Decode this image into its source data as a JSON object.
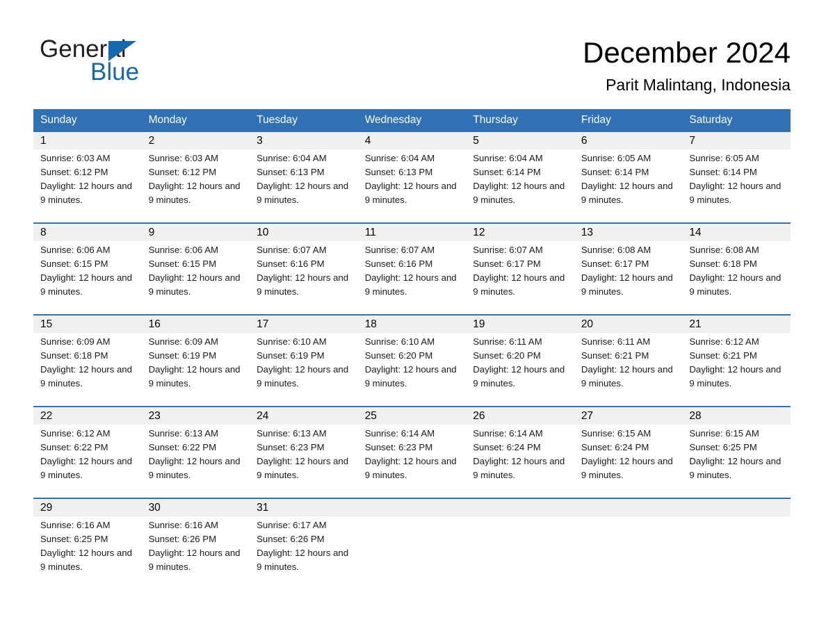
{
  "logo": {
    "word1": "General",
    "word2": "Blue",
    "triangle_color": "#1368b0",
    "text_color": "#231f20"
  },
  "header": {
    "title": "December 2024",
    "subtitle": "Parit Malintang, Indonesia"
  },
  "theme": {
    "header_blue": "#3071b5",
    "daynum_strip": "#f0f0f0",
    "header_text": "#ffffff"
  },
  "calendar": {
    "weekdays": [
      "Sunday",
      "Monday",
      "Tuesday",
      "Wednesday",
      "Thursday",
      "Friday",
      "Saturday"
    ],
    "weeks": [
      [
        {
          "day": "1",
          "sunrise": "Sunrise: 6:03 AM",
          "sunset": "Sunset: 6:12 PM",
          "daylight": "Daylight: 12 hours and 9 minutes."
        },
        {
          "day": "2",
          "sunrise": "Sunrise: 6:03 AM",
          "sunset": "Sunset: 6:12 PM",
          "daylight": "Daylight: 12 hours and 9 minutes."
        },
        {
          "day": "3",
          "sunrise": "Sunrise: 6:04 AM",
          "sunset": "Sunset: 6:13 PM",
          "daylight": "Daylight: 12 hours and 9 minutes."
        },
        {
          "day": "4",
          "sunrise": "Sunrise: 6:04 AM",
          "sunset": "Sunset: 6:13 PM",
          "daylight": "Daylight: 12 hours and 9 minutes."
        },
        {
          "day": "5",
          "sunrise": "Sunrise: 6:04 AM",
          "sunset": "Sunset: 6:14 PM",
          "daylight": "Daylight: 12 hours and 9 minutes."
        },
        {
          "day": "6",
          "sunrise": "Sunrise: 6:05 AM",
          "sunset": "Sunset: 6:14 PM",
          "daylight": "Daylight: 12 hours and 9 minutes."
        },
        {
          "day": "7",
          "sunrise": "Sunrise: 6:05 AM",
          "sunset": "Sunset: 6:14 PM",
          "daylight": "Daylight: 12 hours and 9 minutes."
        }
      ],
      [
        {
          "day": "8",
          "sunrise": "Sunrise: 6:06 AM",
          "sunset": "Sunset: 6:15 PM",
          "daylight": "Daylight: 12 hours and 9 minutes."
        },
        {
          "day": "9",
          "sunrise": "Sunrise: 6:06 AM",
          "sunset": "Sunset: 6:15 PM",
          "daylight": "Daylight: 12 hours and 9 minutes."
        },
        {
          "day": "10",
          "sunrise": "Sunrise: 6:07 AM",
          "sunset": "Sunset: 6:16 PM",
          "daylight": "Daylight: 12 hours and 9 minutes."
        },
        {
          "day": "11",
          "sunrise": "Sunrise: 6:07 AM",
          "sunset": "Sunset: 6:16 PM",
          "daylight": "Daylight: 12 hours and 9 minutes."
        },
        {
          "day": "12",
          "sunrise": "Sunrise: 6:07 AM",
          "sunset": "Sunset: 6:17 PM",
          "daylight": "Daylight: 12 hours and 9 minutes."
        },
        {
          "day": "13",
          "sunrise": "Sunrise: 6:08 AM",
          "sunset": "Sunset: 6:17 PM",
          "daylight": "Daylight: 12 hours and 9 minutes."
        },
        {
          "day": "14",
          "sunrise": "Sunrise: 6:08 AM",
          "sunset": "Sunset: 6:18 PM",
          "daylight": "Daylight: 12 hours and 9 minutes."
        }
      ],
      [
        {
          "day": "15",
          "sunrise": "Sunrise: 6:09 AM",
          "sunset": "Sunset: 6:18 PM",
          "daylight": "Daylight: 12 hours and 9 minutes."
        },
        {
          "day": "16",
          "sunrise": "Sunrise: 6:09 AM",
          "sunset": "Sunset: 6:19 PM",
          "daylight": "Daylight: 12 hours and 9 minutes."
        },
        {
          "day": "17",
          "sunrise": "Sunrise: 6:10 AM",
          "sunset": "Sunset: 6:19 PM",
          "daylight": "Daylight: 12 hours and 9 minutes."
        },
        {
          "day": "18",
          "sunrise": "Sunrise: 6:10 AM",
          "sunset": "Sunset: 6:20 PM",
          "daylight": "Daylight: 12 hours and 9 minutes."
        },
        {
          "day": "19",
          "sunrise": "Sunrise: 6:11 AM",
          "sunset": "Sunset: 6:20 PM",
          "daylight": "Daylight: 12 hours and 9 minutes."
        },
        {
          "day": "20",
          "sunrise": "Sunrise: 6:11 AM",
          "sunset": "Sunset: 6:21 PM",
          "daylight": "Daylight: 12 hours and 9 minutes."
        },
        {
          "day": "21",
          "sunrise": "Sunrise: 6:12 AM",
          "sunset": "Sunset: 6:21 PM",
          "daylight": "Daylight: 12 hours and 9 minutes."
        }
      ],
      [
        {
          "day": "22",
          "sunrise": "Sunrise: 6:12 AM",
          "sunset": "Sunset: 6:22 PM",
          "daylight": "Daylight: 12 hours and 9 minutes."
        },
        {
          "day": "23",
          "sunrise": "Sunrise: 6:13 AM",
          "sunset": "Sunset: 6:22 PM",
          "daylight": "Daylight: 12 hours and 9 minutes."
        },
        {
          "day": "24",
          "sunrise": "Sunrise: 6:13 AM",
          "sunset": "Sunset: 6:23 PM",
          "daylight": "Daylight: 12 hours and 9 minutes."
        },
        {
          "day": "25",
          "sunrise": "Sunrise: 6:14 AM",
          "sunset": "Sunset: 6:23 PM",
          "daylight": "Daylight: 12 hours and 9 minutes."
        },
        {
          "day": "26",
          "sunrise": "Sunrise: 6:14 AM",
          "sunset": "Sunset: 6:24 PM",
          "daylight": "Daylight: 12 hours and 9 minutes."
        },
        {
          "day": "27",
          "sunrise": "Sunrise: 6:15 AM",
          "sunset": "Sunset: 6:24 PM",
          "daylight": "Daylight: 12 hours and 9 minutes."
        },
        {
          "day": "28",
          "sunrise": "Sunrise: 6:15 AM",
          "sunset": "Sunset: 6:25 PM",
          "daylight": "Daylight: 12 hours and 9 minutes."
        }
      ],
      [
        {
          "day": "29",
          "sunrise": "Sunrise: 6:16 AM",
          "sunset": "Sunset: 6:25 PM",
          "daylight": "Daylight: 12 hours and 9 minutes."
        },
        {
          "day": "30",
          "sunrise": "Sunrise: 6:16 AM",
          "sunset": "Sunset: 6:26 PM",
          "daylight": "Daylight: 12 hours and 9 minutes."
        },
        {
          "day": "31",
          "sunrise": "Sunrise: 6:17 AM",
          "sunset": "Sunset: 6:26 PM",
          "daylight": "Daylight: 12 hours and 9 minutes."
        },
        {
          "day": "",
          "sunrise": "",
          "sunset": "",
          "daylight": ""
        },
        {
          "day": "",
          "sunrise": "",
          "sunset": "",
          "daylight": ""
        },
        {
          "day": "",
          "sunrise": "",
          "sunset": "",
          "daylight": ""
        },
        {
          "day": "",
          "sunrise": "",
          "sunset": "",
          "daylight": ""
        }
      ]
    ]
  }
}
